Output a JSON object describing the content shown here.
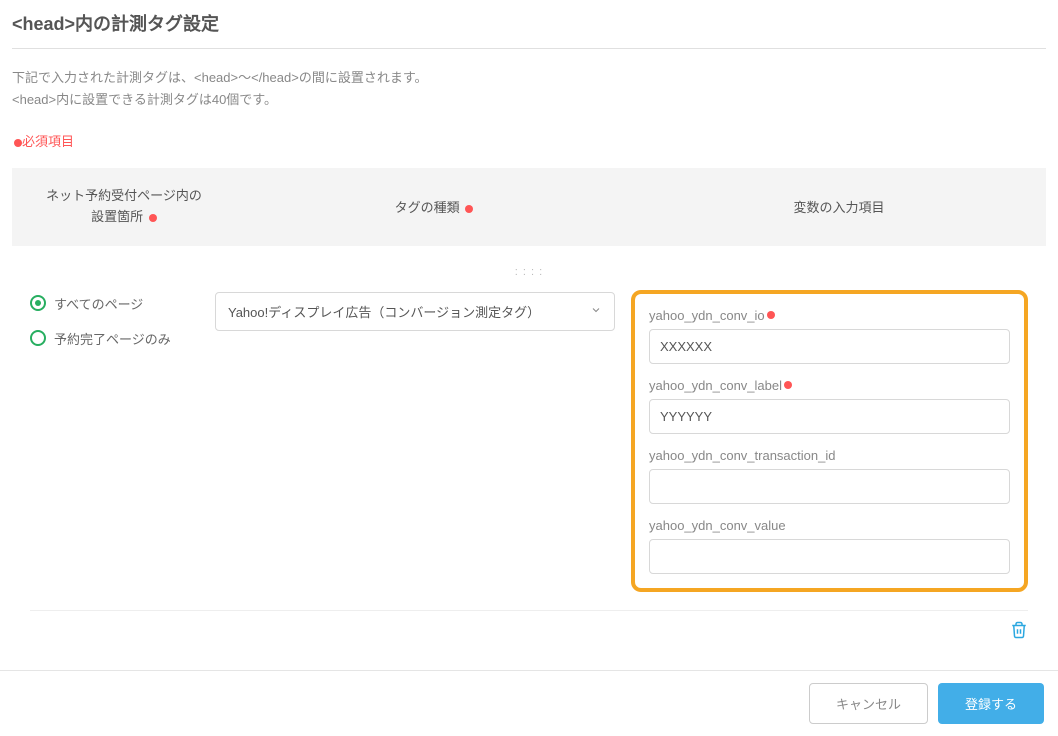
{
  "page": {
    "title": "<head>内の計測タグ設定",
    "description_line1": "下記で入力された計測タグは、<head>〜</head>の間に設置されます。",
    "description_line2": "<head>内に設置できる計測タグは40個です。",
    "required_note": "必須項目"
  },
  "table_header": {
    "location": "ネット予約受付ページ内の\n設置箇所",
    "tag_type": "タグの種類",
    "variables": "変数の入力項目"
  },
  "radio": {
    "all_pages": "すべてのページ",
    "completion_only": "予約完了ページのみ"
  },
  "select": {
    "selected": "Yahoo!ディスプレイ広告（コンバージョン測定タグ）"
  },
  "fields": [
    {
      "label": "yahoo_ydn_conv_io",
      "required": true,
      "value": "XXXXXX"
    },
    {
      "label": "yahoo_ydn_conv_label",
      "required": true,
      "value": "YYYYYY"
    },
    {
      "label": "yahoo_ydn_conv_transaction_id",
      "required": false,
      "value": ""
    },
    {
      "label": "yahoo_ydn_conv_value",
      "required": false,
      "value": ""
    }
  ],
  "footer": {
    "cancel": "キャンセル",
    "submit": "登録する"
  }
}
